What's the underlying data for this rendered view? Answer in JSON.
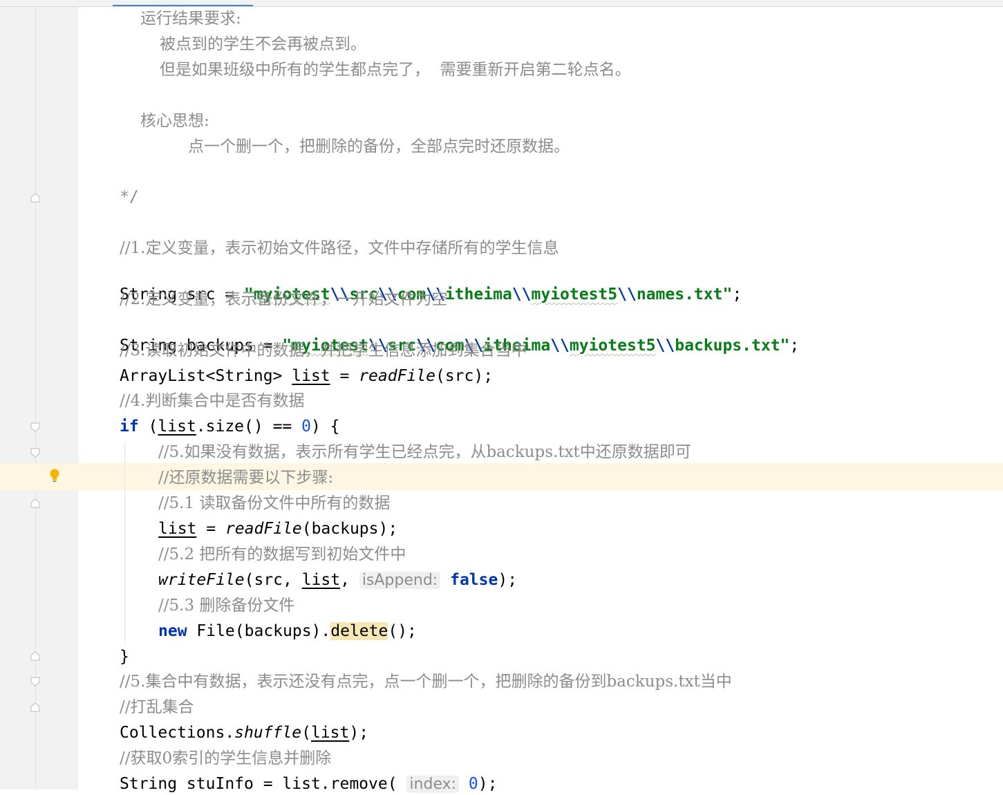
{
  "comment_block": {
    "heading1": "运行结果要求:",
    "req1": "被点到的学生不会再被点到。",
    "req2": "但是如果班级中所有的学生都点完了，  需要重新开启第二轮点名。",
    "heading2": "核心思想:",
    "idea": "点一个删一个，把删除的备份，全部点完时还原数据。",
    "close": "*/"
  },
  "code": {
    "c1": "//1.定义变量，表示初始文件路径，文件中存储所有的学生信息",
    "l1_type": "String src = ",
    "l1_str_a": "myiotest",
    "l1_str_b": "src",
    "l1_str_c": "com",
    "l1_str_d": "itheima",
    "l1_str_e": "myiotest5",
    "l1_str_f": "names.txt",
    "c2": "//2.定义变量，表示备份文件，一开始文件为空",
    "l2_type": "String backups = ",
    "l2_str_f": "backups.txt",
    "c3": "//3.读取初始文件中的数据，并把学生信息添加到集合当中",
    "l3_a": "ArrayList<String> ",
    "l3_var": "list",
    "l3_b": " = ",
    "l3_call": "readFile",
    "l3_c": "(src);",
    "c4": "//4.判断集合中是否有数据",
    "l4_kw": "if",
    "l4_a": " (",
    "l4_b": ".size() == ",
    "l4_num": "0",
    "l4_c": ") {",
    "c5": "//5.如果没有数据，表示所有学生已经点完，从backups.txt中还原数据即可",
    "c6": "//还原数据需要以下步骤:",
    "c51": "//5.1 读取备份文件中所有的数据",
    "l51_b": " = ",
    "l51_c": "(backups);",
    "c52": "//5.2 把所有的数据写到初始文件中",
    "l52_call": "writeFile",
    "l52_a": "(src, ",
    "l52_b": ", ",
    "l52_hint": "isAppend:",
    "l52_kw": "false",
    "l52_c": ");",
    "c53": "//5.3 删除备份文件",
    "l53_kw": "new",
    "l53_a": " File(backups).",
    "l53_m": "delete",
    "l53_c": "();",
    "close_brace": "}",
    "c7": "//5.集合中有数据，表示还没有点完，点一个删一个，把删除的备份到backups.txt当中",
    "c8": "//打乱集合",
    "l8_a": "Collections.",
    "l8_call": "shuffle",
    "l8_b": "(",
    "l8_c": ");",
    "c9": "//获取0索引的学生信息并删除",
    "l9_a": "String stuInfo = list.remove( ",
    "l9_hint": "index:",
    "l9_num": "0",
    "l9_c": ");"
  },
  "icons": {
    "fold": "fold-marker-icon",
    "bulb": "lightbulb-icon"
  },
  "colors": {
    "keyword": "#0033b3",
    "string": "#067d17",
    "comment": "#8c8c8c",
    "number": "#1750eb",
    "highlight_row": "#fdf6e3"
  }
}
